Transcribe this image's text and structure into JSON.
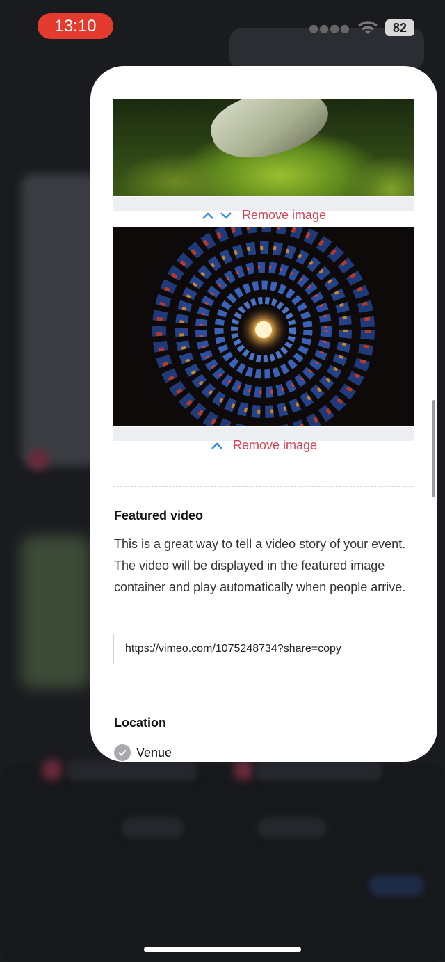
{
  "status_bar": {
    "time": "13:10",
    "battery": "82",
    "accent_color": "#e43b2e"
  },
  "images": [
    {
      "remove_label": "Remove image",
      "subject": "butterfly on a green leaf"
    },
    {
      "remove_label": "Remove image",
      "subject": "stained glass spiral ceiling"
    }
  ],
  "featured_video": {
    "title": "Featured video",
    "description": "This is a great way to tell a video story of your event. The video will be displayed in the featured image container and play automatically when people arrive.",
    "url_value": "https://vimeo.com/1075248734?share=copy"
  },
  "location": {
    "title": "Location",
    "option_label": "Venue"
  },
  "colors": {
    "link_red": "#d14455",
    "arrow_blue": "#3a8fd6"
  }
}
